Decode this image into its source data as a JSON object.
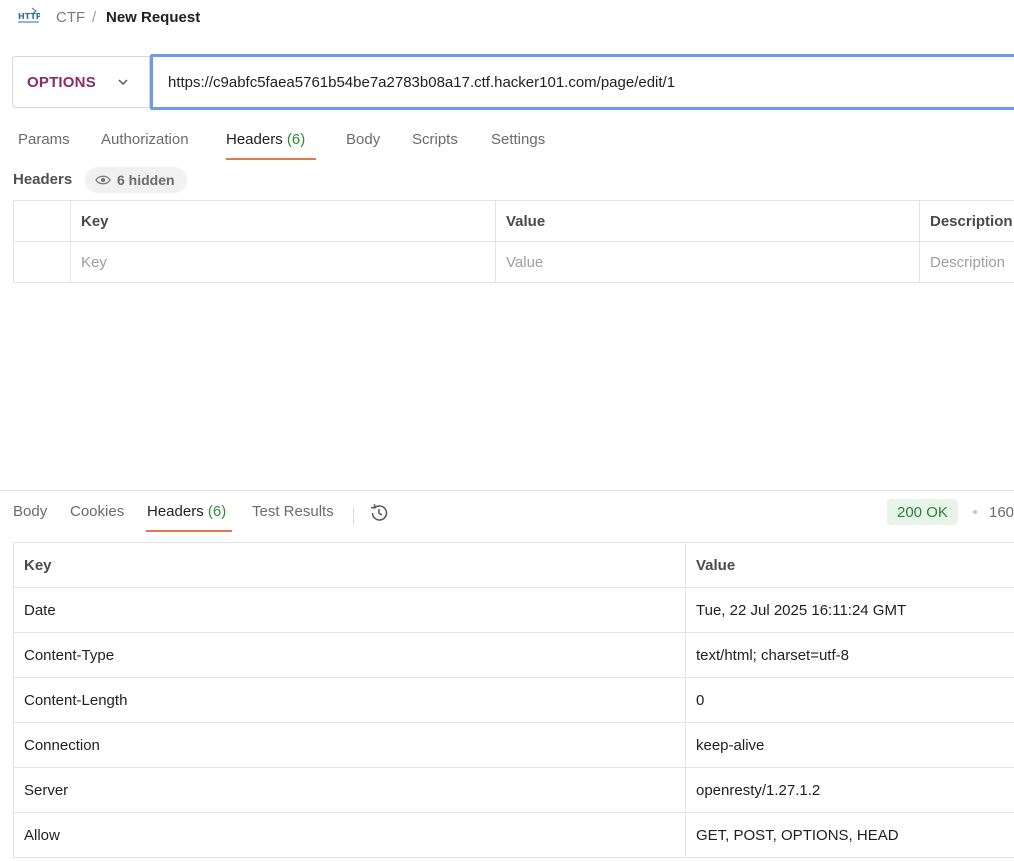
{
  "breadcrumb": {
    "icon": "http-icon",
    "parent": "CTF",
    "separator": "/",
    "current": "New Request"
  },
  "request": {
    "method": "OPTIONS",
    "url": "https://c9abfc5faea5761b54be7a2783b08a17.ctf.hacker101.com/page/edit/1"
  },
  "request_tabs": [
    {
      "label": "Params",
      "count": ""
    },
    {
      "label": "Authorization",
      "count": ""
    },
    {
      "label": "Headers",
      "count": "(6)"
    },
    {
      "label": "Body",
      "count": ""
    },
    {
      "label": "Scripts",
      "count": ""
    },
    {
      "label": "Settings",
      "count": ""
    }
  ],
  "active_request_tab": "Headers",
  "headers_section": {
    "label": "Headers",
    "hidden_pill": "6 hidden"
  },
  "request_headers_table": {
    "columns": [
      "Key",
      "Value",
      "Description"
    ],
    "placeholders": [
      "Key",
      "Value",
      "Description"
    ]
  },
  "response_tabs": [
    {
      "label": "Body",
      "count": ""
    },
    {
      "label": "Cookies",
      "count": ""
    },
    {
      "label": "Headers",
      "count": "(6)"
    },
    {
      "label": "Test Results",
      "count": ""
    }
  ],
  "active_response_tab": "Headers",
  "response_status": {
    "status": "200 OK",
    "time": "160"
  },
  "response_headers": {
    "columns": [
      "Key",
      "Value"
    ],
    "rows": [
      {
        "key": "Date",
        "value": "Tue, 22 Jul 2025 16:11:24 GMT"
      },
      {
        "key": "Content-Type",
        "value": "text/html; charset=utf-8"
      },
      {
        "key": "Content-Length",
        "value": "0"
      },
      {
        "key": "Connection",
        "value": "keep-alive"
      },
      {
        "key": "Server",
        "value": "openresty/1.27.1.2"
      },
      {
        "key": "Allow",
        "value": "GET, POST, OPTIONS, HEAD"
      }
    ]
  },
  "colors": {
    "method": "#8a2a6b",
    "tab_accent": "#e0794c",
    "url_border": "#6a9ee0",
    "status_ok_bg": "#e7f5e9",
    "status_ok_text": "#2e7d3c",
    "count_text": "#2e8b3a"
  }
}
